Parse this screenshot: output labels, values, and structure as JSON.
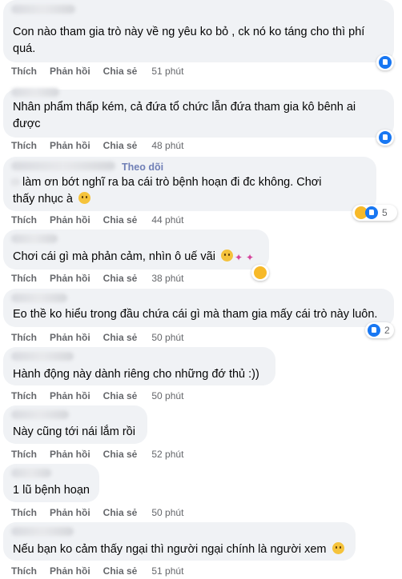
{
  "actions": {
    "like": "Thích",
    "reply": "Phản hồi",
    "share": "Chia sẻ"
  },
  "follow_label": "Theo dõi",
  "comments": [
    {
      "line1": "Con nào tham gia trò này về ng yêu ko bỏ , ck nó ko táng cho thì phí",
      "line2": "quá.",
      "time": "51 phút"
    },
    {
      "line1": "Nhân phẩm thấp kém, cả đứa tổ chức lẫn đứa tham gia kô bênh ai",
      "line2": "được",
      "time": "48 phút"
    },
    {
      "line1": "làm ơn bớt nghĩ ra ba cái trò bệnh hoạn đi đc không. Chơi",
      "line2": "thấy nhục à",
      "time": "44 phút",
      "reaction_count": "5"
    },
    {
      "line1": "Chơi cái gì mà phản cảm, nhìn ô uế vãi",
      "time": "38 phút"
    },
    {
      "line1": "Eo thề ko hiểu trong đầu chứa cái gì mà tham gia mấy cái trò này luôn.",
      "time": "50 phút",
      "reaction_count": "2"
    },
    {
      "line1": "Hành động này dành riêng cho những đớ thủ :))",
      "time": "50 phút"
    },
    {
      "line1": "Này cũng tới nái lắm rồi",
      "time": "52 phút"
    },
    {
      "line1": "1 lũ bệnh hoạn",
      "time": "50 phút"
    },
    {
      "line1": "Nếu bạn ko cảm thấy ngại thì người ngại chính là người xem",
      "time": "51 phút"
    }
  ]
}
